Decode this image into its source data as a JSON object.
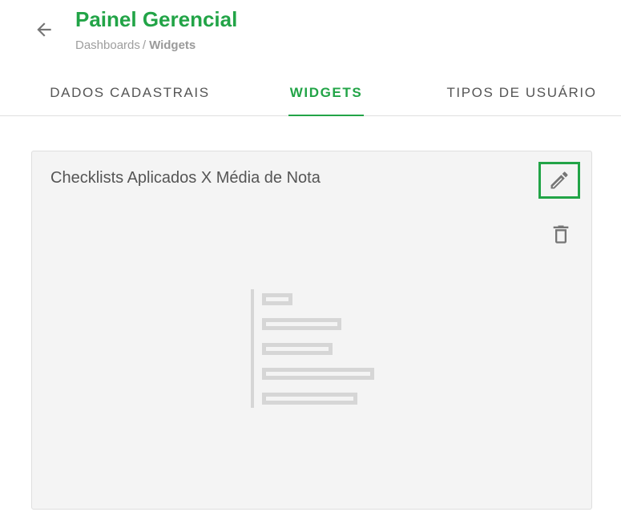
{
  "header": {
    "title": "Painel Gerencial",
    "back_icon": "arrow-left-icon",
    "breadcrumb": {
      "parent": "Dashboards",
      "separator": "/",
      "current": "Widgets"
    }
  },
  "tabs": [
    {
      "label": "DADOS CADASTRAIS",
      "active": false
    },
    {
      "label": "WIDGETS",
      "active": true
    },
    {
      "label": "TIPOS DE USUÁRIO",
      "active": false
    }
  ],
  "widget_card": {
    "title": "Checklists Aplicados X Média de Nota",
    "edit_icon": "pencil-icon",
    "delete_icon": "trash-icon",
    "placeholder_icon": "bar-chart-placeholder-icon"
  },
  "colors": {
    "accent": "#22a447",
    "text": "#555555",
    "muted": "#9e9e9e",
    "card_bg": "#f4f4f4",
    "placeholder": "#d6d6d6"
  }
}
